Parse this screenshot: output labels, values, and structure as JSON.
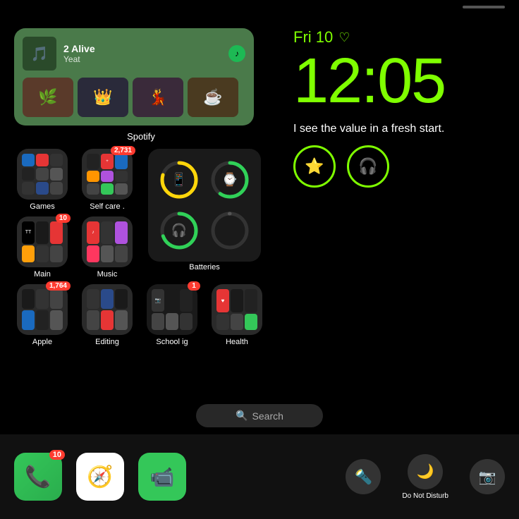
{
  "statusBar": {
    "indicator": "─"
  },
  "spotify": {
    "label": "Spotify",
    "songTitle": "2 Alive",
    "songArtist": "Yeat",
    "albumEmojis": [
      "🌿",
      "👑",
      "💃",
      "☕"
    ]
  },
  "clock": {
    "date": "Fri 10",
    "time": "12:05",
    "quote": "I see the value in a fresh start.",
    "heartSymbol": "♡"
  },
  "appFolders": {
    "games": {
      "label": "Games",
      "badge": null
    },
    "selfCare": {
      "label": "Self care .",
      "badge": "2,731"
    },
    "main": {
      "label": "Main",
      "badge": "10"
    },
    "music": {
      "label": "Music",
      "badge": null
    },
    "batteries": {
      "label": "Batteries",
      "badge": null
    },
    "apple": {
      "label": "Apple",
      "badge": "1,764"
    },
    "editing": {
      "label": "Editing",
      "badge": null
    },
    "schoolIg": {
      "label": "School ig",
      "badge": "1"
    },
    "health": {
      "label": "Health",
      "badge": null
    }
  },
  "batteries": [
    {
      "icon": "📱",
      "color": "yellow",
      "percent": 80
    },
    {
      "icon": "⌚",
      "color": "green",
      "percent": 60
    },
    {
      "icon": "🎧",
      "color": "green",
      "percent": 70
    },
    {
      "icon": "",
      "color": "gray",
      "percent": 0
    }
  ],
  "search": {
    "placeholder": "Search",
    "icon": "🔍"
  },
  "dock": {
    "apps": [
      {
        "name": "Phone",
        "badge": "10",
        "emoji": "📞",
        "bg": "#34c759"
      },
      {
        "name": "Safari",
        "emoji": "🧭",
        "bg": "#fff"
      },
      {
        "name": "FaceTime",
        "emoji": "📹",
        "bg": "#34c759"
      }
    ],
    "rightButtons": [
      {
        "name": "Flashlight",
        "emoji": "🔦"
      },
      {
        "name": "Do Not Disturb",
        "label": "Do Not Disturb",
        "emoji": "🌙"
      },
      {
        "name": "Camera",
        "emoji": "📷"
      }
    ]
  }
}
